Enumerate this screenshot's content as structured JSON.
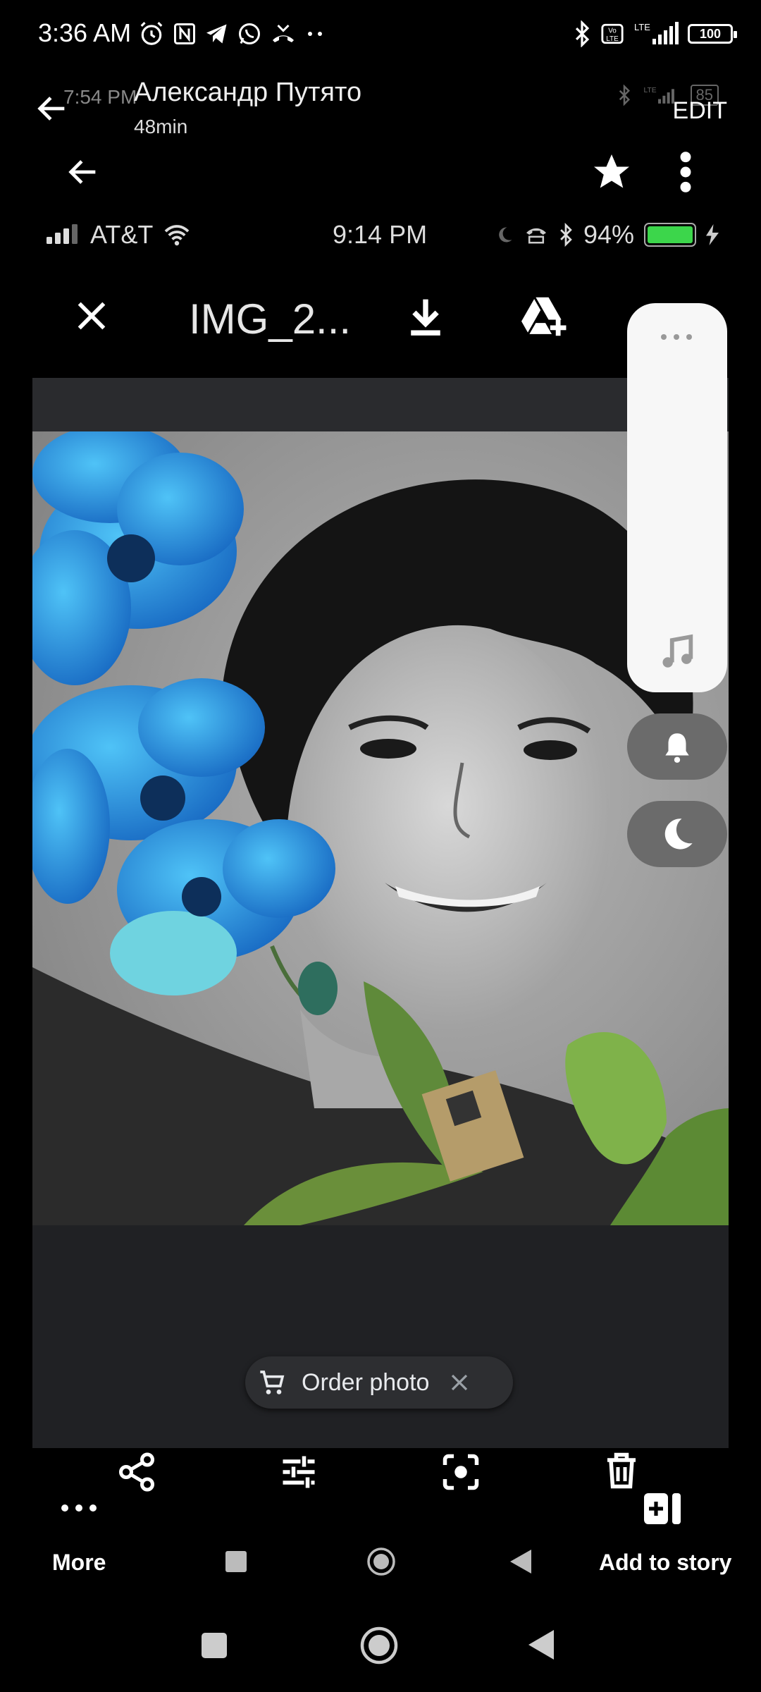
{
  "status_bar": {
    "time": "3:36 AM",
    "battery": "100"
  },
  "story": {
    "ghost_time": "7:54 PM",
    "ghost_battery": "85",
    "author_name": "Александр Путято",
    "time_ago": "48min",
    "edit_label": "EDIT"
  },
  "inner_screenshot": {
    "carrier": "AT&T",
    "time": "9:14 PM",
    "battery_percent": "94%",
    "file_title": "IMG_2...",
    "order_chip_label": "Order photo"
  },
  "bottom_bar": {
    "more_label": "More",
    "add_to_story_label": "Add to story"
  },
  "colors": {
    "background": "#000000",
    "panel": "#202124",
    "chip": "#2d2e31",
    "volume_panel": "#f7f7f7",
    "battery_green": "#3cd64b"
  },
  "icons": {
    "status_left": [
      "alarm-icon",
      "nfc-icon",
      "telegram-icon",
      "whatsapp-icon",
      "missed-call-icon",
      "more-dots-icon"
    ],
    "status_right": [
      "bluetooth-icon",
      "volte-icon",
      "lte-signal-icon",
      "battery-icon"
    ]
  }
}
